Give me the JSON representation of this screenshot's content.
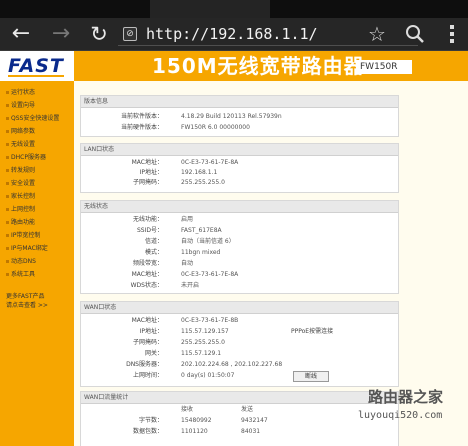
{
  "browser": {
    "url": "http://192.168.1.1/",
    "site_icon": "no-tracking-icon"
  },
  "header": {
    "logo": "FAST",
    "title": "150M无线宽带路由器",
    "model": "FW150R"
  },
  "sidebar": {
    "items": [
      "运行状态",
      "设置向导",
      "QSS安全快速设置",
      "网络参数",
      "无线设置",
      "DHCP服务器",
      "转发规则",
      "安全设置",
      "家长控制",
      "上网控制",
      "路由功能",
      "IP带宽控制",
      "IP与MAC绑定",
      "动态DNS",
      "系统工具"
    ],
    "footer": [
      "更多FAST产品",
      "请点击查看 >>"
    ]
  },
  "panels": {
    "version": {
      "title": "版本信息",
      "rows": [
        {
          "label": "当前软件版本：",
          "value": "4.18.29 Build 120113 Rel.57939n"
        },
        {
          "label": "当前硬件版本：",
          "value": "FW150R 6.0 00000000"
        }
      ]
    },
    "lan": {
      "title": "LAN口状态",
      "rows": [
        {
          "label": "MAC地址：",
          "value": "0C-E3-73-61-7E-8A"
        },
        {
          "label": "IP地址：",
          "value": "192.168.1.1"
        },
        {
          "label": "子网掩码：",
          "value": "255.255.255.0"
        }
      ]
    },
    "wireless": {
      "title": "无线状态",
      "rows": [
        {
          "label": "无线功能：",
          "value": "启用"
        },
        {
          "label": "SSID号：",
          "value": "FAST_617E8A"
        },
        {
          "label": "信道：",
          "value": "自动（当前信道 6）"
        },
        {
          "label": "模式：",
          "value": "11bgn mixed"
        },
        {
          "label": "频段带宽：",
          "value": "自动"
        },
        {
          "label": "MAC地址：",
          "value": "0C-E3-73-61-7E-8A"
        },
        {
          "label": "WDS状态：",
          "value": "未开启"
        }
      ]
    },
    "wan": {
      "title": "WAN口状态",
      "rows": [
        {
          "label": "MAC地址：",
          "value": "0C-E3-73-61-7E-8B"
        },
        {
          "label": "IP地址：",
          "value": "115.57.129.157",
          "extra": "PPPoE按需连接"
        },
        {
          "label": "子网掩码：",
          "value": "255.255.255.0"
        },
        {
          "label": "网关：",
          "value": "115.57.129.1"
        },
        {
          "label": "DNS服务器：",
          "value": "202.102.224.68 , 202.102.227.68"
        },
        {
          "label": "上网时间：",
          "value": "0 day(s) 01:50:07",
          "button": "断线"
        }
      ]
    },
    "traffic": {
      "title": "WAN口流量统计",
      "headers": [
        "接收",
        "发送"
      ],
      "rows": [
        {
          "label": "字节数：",
          "values": [
            "15480992",
            "9432147"
          ]
        },
        {
          "label": "数据包数：",
          "values": [
            "1101120",
            "84031"
          ]
        }
      ]
    }
  },
  "watermark": {
    "line1": "路由器之家",
    "line2": "luyouqi520.com"
  }
}
